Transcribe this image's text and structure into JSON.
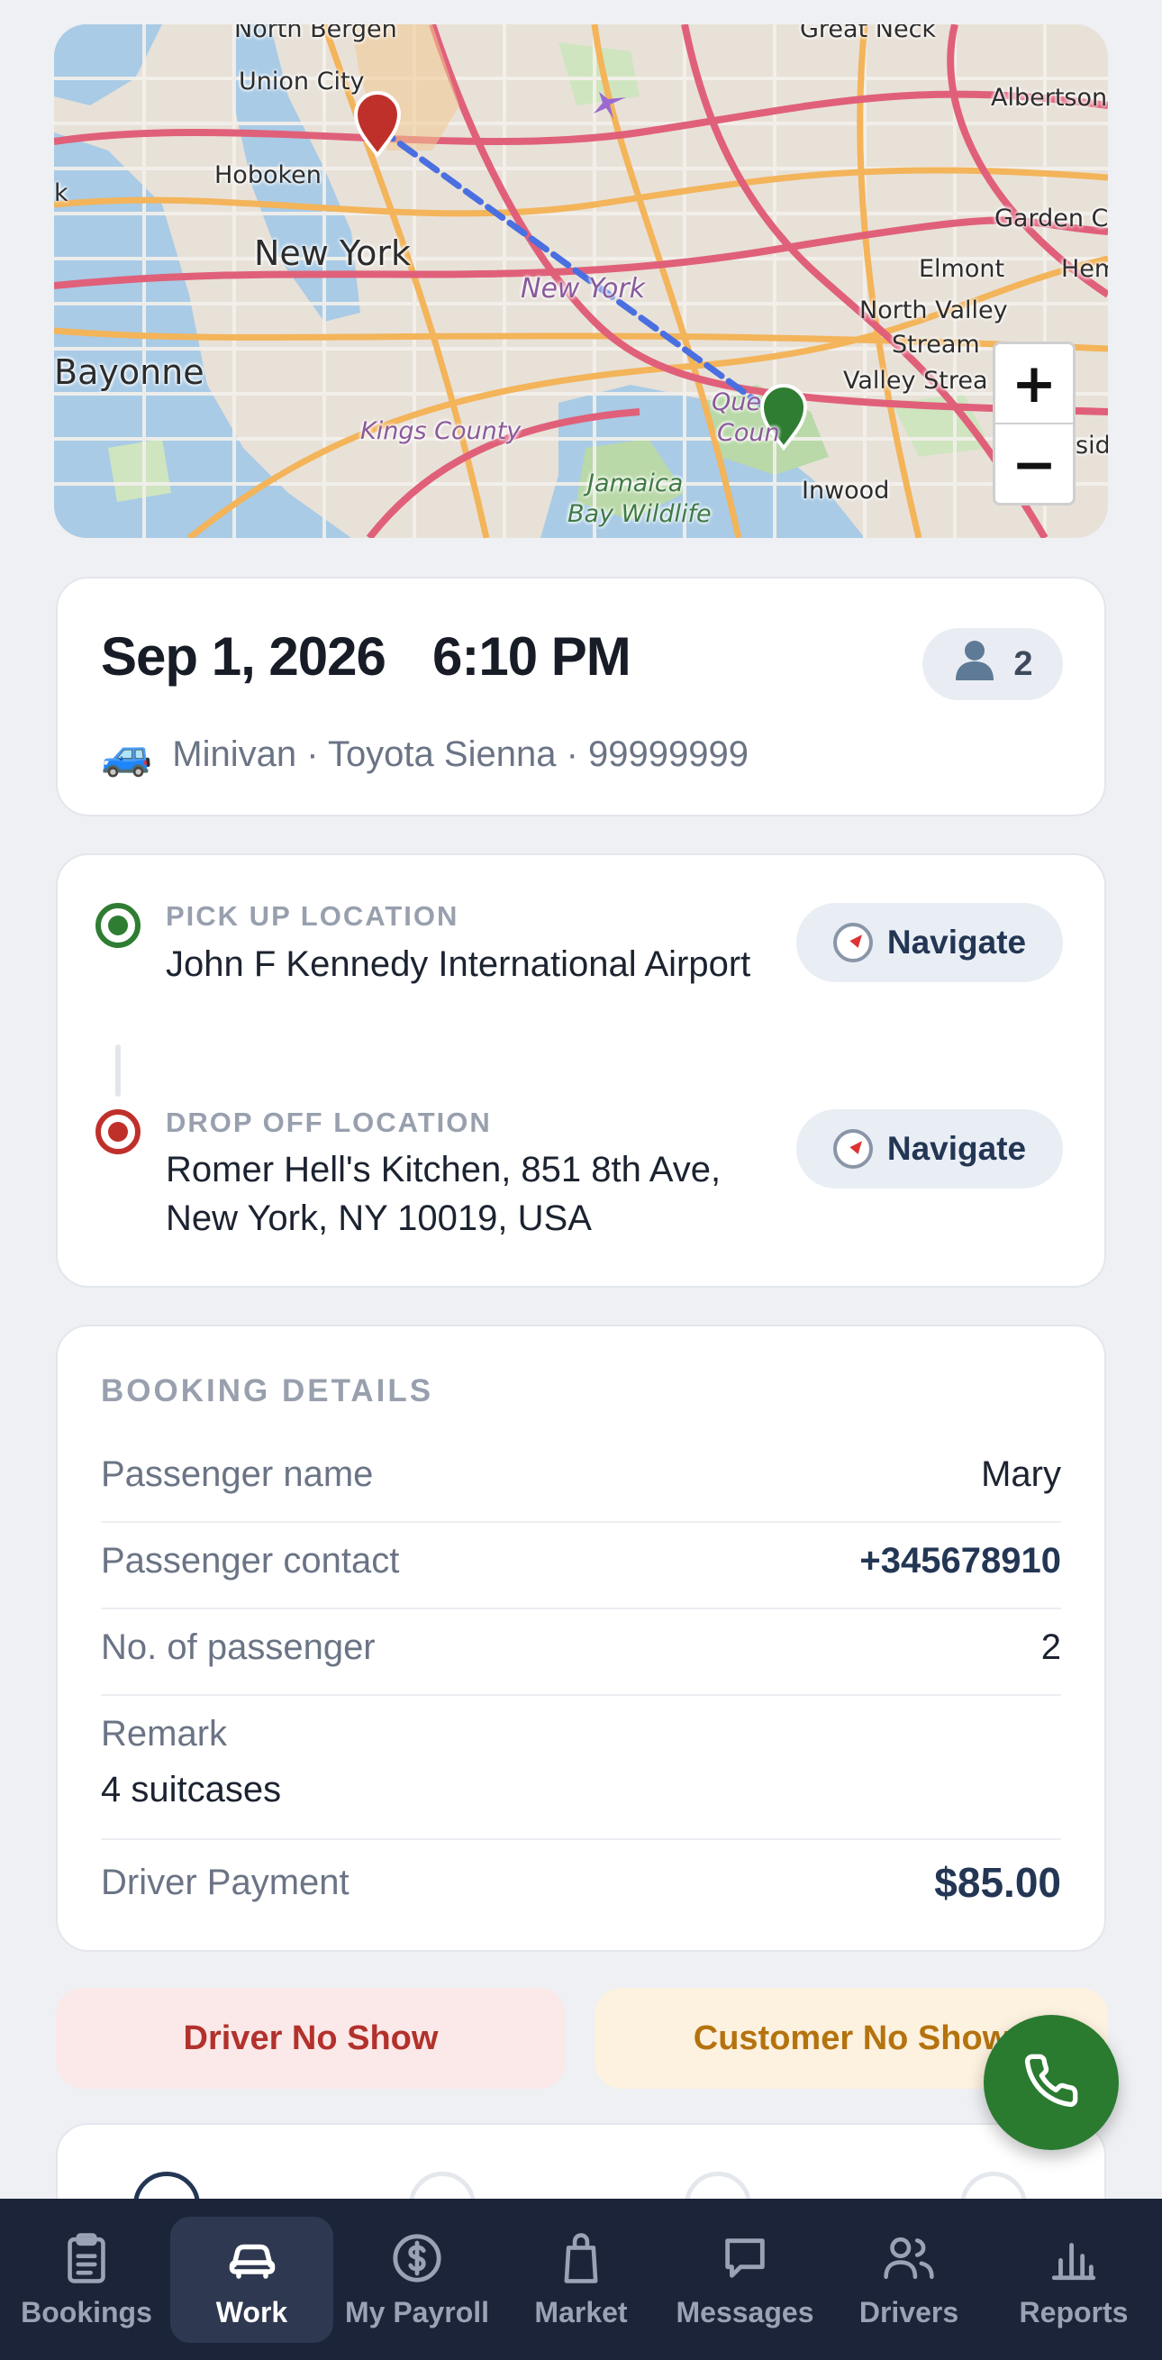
{
  "map": {
    "labels": {
      "north_bergen": "North Bergen",
      "great_neck": "Great Neck",
      "union_city": "Union City",
      "albertson": "Albertson",
      "hoboken": "Hoboken",
      "new_york_big": "New York",
      "garden_city": "Garden C",
      "new_york_purple": "New York",
      "elmont": "Elmont",
      "hempstead": "Hemps",
      "north_valley": "North Valley",
      "stream": "Stream",
      "bayonne": "Bayonne",
      "valley_stream": "Valley Strea",
      "kings_county": "Kings County",
      "queens_county_1": "Que",
      "queens_county_2": "Coun",
      "inwood": "Inwood",
      "jamaica": "Jamaica",
      "bay_wildlife": "Bay Wildlife",
      "k_fragment": "k",
      "sid_fragment": "sid"
    },
    "zoom_in": "+",
    "zoom_out": "−",
    "pickup_marker_color": "#2f7d32",
    "dropoff_marker_color": "#c0302b",
    "route_color": "#4a6fe0"
  },
  "booking": {
    "date": "Sep 1, 2026",
    "time": "6:10 PM",
    "passenger_count": "2",
    "passenger_icon": "person-icon",
    "vehicle_icon": "🚙",
    "vehicle": "Minivan · Toyota Sienna · 99999999"
  },
  "locations": {
    "pickup_title": "PICK UP LOCATION",
    "pickup_address": "John F Kennedy International Airport",
    "dropoff_title": "DROP OFF LOCATION",
    "dropoff_address": "Romer Hell's Kitchen, 851 8th Ave, New York, NY 10019, USA",
    "navigate_label": "Navigate"
  },
  "details": {
    "title": "BOOKING DETAILS",
    "passenger_name_label": "Passenger name",
    "passenger_name": "Mary",
    "passenger_contact_label": "Passenger contact",
    "passenger_contact": "+345678910",
    "passenger_count_label": "No. of passenger",
    "passenger_count": "2",
    "remark_label": "Remark",
    "remark": "4 suitcases",
    "payment_label": "Driver Payment",
    "payment": "$85.00"
  },
  "actions": {
    "driver_no_show": "Driver No Show",
    "customer_no_show": "Customer No Show",
    "call_icon": "phone-icon"
  },
  "tabbar": {
    "items": [
      {
        "label": "Bookings",
        "icon": "clipboard-icon"
      },
      {
        "label": "Work",
        "icon": "car-icon",
        "active": true
      },
      {
        "label": "My Payroll",
        "icon": "dollar-icon"
      },
      {
        "label": "Market",
        "icon": "shopping-bag-icon"
      },
      {
        "label": "Messages",
        "icon": "chat-icon"
      },
      {
        "label": "Drivers",
        "icon": "users-icon"
      },
      {
        "label": "Reports",
        "icon": "bar-chart-icon"
      }
    ]
  },
  "colors": {
    "primary_dark": "#1b2438",
    "accent_navy": "#233654",
    "danger": "#b3312c",
    "warning": "#b5730e",
    "success": "#2a7b30"
  }
}
